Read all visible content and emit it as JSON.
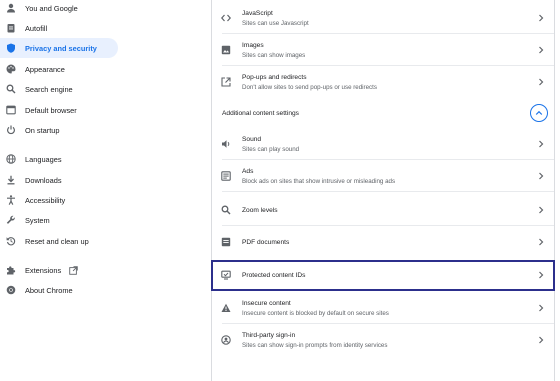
{
  "sidebar": {
    "items": [
      {
        "label": "You and Google",
        "icon": "person-icon"
      },
      {
        "label": "Autofill",
        "icon": "clipboard-icon"
      },
      {
        "label": "Privacy and security",
        "icon": "shield-icon",
        "active": true
      },
      {
        "label": "Appearance",
        "icon": "palette-icon"
      },
      {
        "label": "Search engine",
        "icon": "search-icon"
      },
      {
        "label": "Default browser",
        "icon": "browser-icon"
      },
      {
        "label": "On startup",
        "icon": "power-icon"
      },
      {
        "label": "Languages",
        "icon": "globe-icon"
      },
      {
        "label": "Downloads",
        "icon": "download-icon"
      },
      {
        "label": "Accessibility",
        "icon": "accessibility-icon"
      },
      {
        "label": "System",
        "icon": "wrench-icon"
      },
      {
        "label": "Reset and clean up",
        "icon": "reset-icon"
      },
      {
        "label": "Extensions",
        "icon": "puzzle-icon"
      },
      {
        "label": "About Chrome",
        "icon": "chrome-icon"
      }
    ]
  },
  "content": {
    "rows_top": [
      {
        "title": "JavaScript",
        "subtitle": "Sites can use Javascript",
        "icon": "code-icon"
      },
      {
        "title": "Images",
        "subtitle": "Sites can show images",
        "icon": "image-icon"
      },
      {
        "title": "Pop-ups and redirects",
        "subtitle": "Don't allow sites to send pop-ups or use redirects",
        "icon": "popup-icon"
      }
    ],
    "section_title": "Additional content settings",
    "rows_additional": [
      {
        "title": "Sound",
        "subtitle": "Sites can play sound",
        "icon": "speaker-icon"
      },
      {
        "title": "Ads",
        "subtitle": "Block ads on sites that show intrusive or misleading ads",
        "icon": "ads-icon"
      },
      {
        "title": "Zoom levels",
        "subtitle": "",
        "icon": "zoom-icon"
      },
      {
        "title": "PDF documents",
        "subtitle": "",
        "icon": "pdf-icon"
      },
      {
        "title": "Protected content IDs",
        "subtitle": "",
        "icon": "protected-content-icon"
      },
      {
        "title": "Insecure content",
        "subtitle": "Insecure content is blocked by default on secure sites",
        "icon": "warning-icon"
      },
      {
        "title": "Third-party sign-in",
        "subtitle": "Sites can show sign-in prompts from identity services",
        "icon": "sign-in-icon"
      }
    ]
  },
  "colors": {
    "accent": "#1a73e8",
    "active_bg": "#e8f0fe",
    "highlight_border": "#2c2f8c"
  }
}
